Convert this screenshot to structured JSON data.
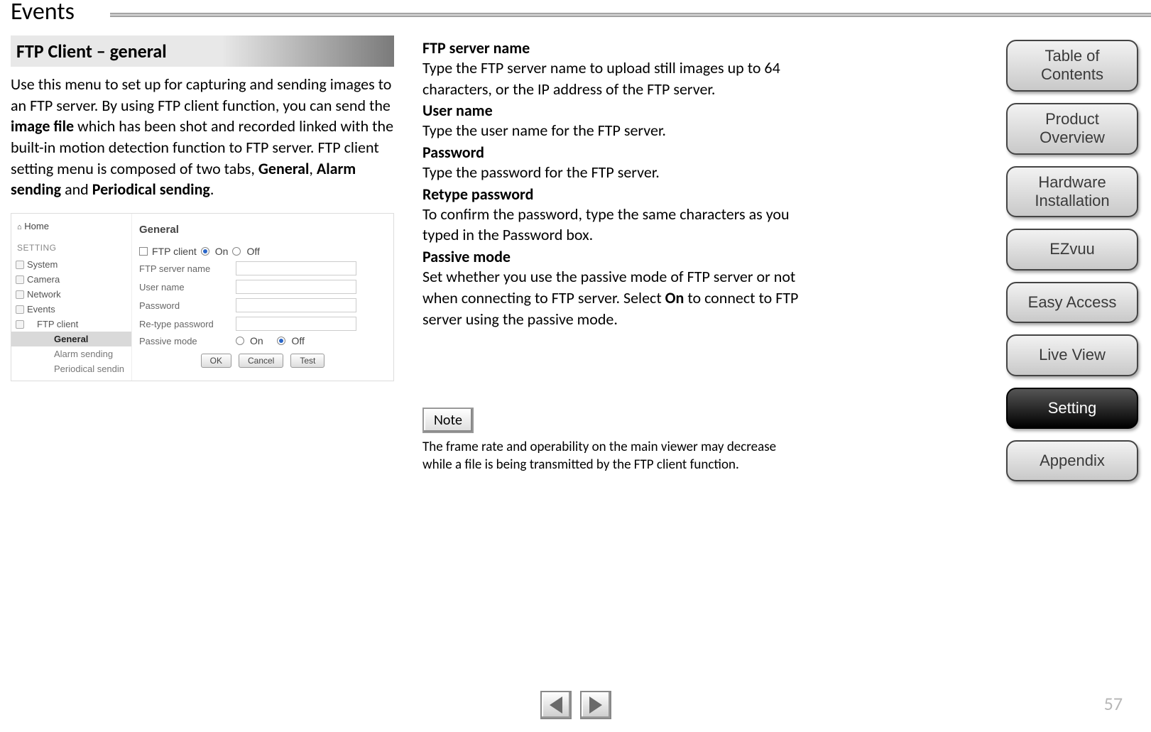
{
  "page_title": "Events",
  "section_heading": "FTP Client – general",
  "intro_parts": {
    "p1": "Use this menu to set up for capturing and sending images to an FTP server. By using FTP client function, you can send the ",
    "b1": "image file",
    "p2": " which has been shot and recorded linked with the built-in motion detection function to FTP server. FTP client setting menu is composed of two tabs, ",
    "b2": "General",
    "comma": ", ",
    "b3": "Alarm sending",
    "and": " and ",
    "b4": "Periodical sending",
    "end": "."
  },
  "screenshot": {
    "home": "Home",
    "setting_header": "SETTING",
    "tree": [
      "System",
      "Camera",
      "Network",
      "Events"
    ],
    "sub": "FTP client",
    "sub2": [
      "General",
      "Alarm sending",
      "Periodical sendin"
    ],
    "main_heading": "General",
    "ftp_client_label": "FTP client",
    "on": "On",
    "off": "Off",
    "rows": [
      "FTP server name",
      "User name",
      "Password",
      "Re-type password",
      "Passive mode"
    ],
    "buttons": [
      "OK",
      "Cancel",
      "Test"
    ]
  },
  "definitions": [
    {
      "term": "FTP server name",
      "desc": "Type the FTP server name to upload still images up to 64 characters, or the IP address of the FTP server."
    },
    {
      "term": "User name",
      "desc": "Type the user name for the FTP server."
    },
    {
      "term": "Password",
      "desc": "Type the password for the FTP server."
    },
    {
      "term": "Retype password",
      "desc": "To confirm the password, type the same characters as you typed in the Password box."
    }
  ],
  "passive": {
    "term": "Passive mode",
    "p1": "Set whether you use the passive mode of FTP server or not when connecting to FTP server. Select ",
    "b1": "On",
    "p2": " to connect to FTP server using the passive mode."
  },
  "note_label": "Note",
  "note_text": "The frame rate and operability on the main viewer may decrease while a file is being transmitted by the FTP client function.",
  "page_number": "57",
  "side_nav": [
    {
      "label": "Table of Contents",
      "lines": [
        "Table of",
        "Contents"
      ],
      "active": false
    },
    {
      "label": "Product Overview",
      "lines": [
        "Product",
        "Overview"
      ],
      "active": false
    },
    {
      "label": "Hardware Installation",
      "lines": [
        "Hardware",
        "Installation"
      ],
      "active": false
    },
    {
      "label": "EZvuu",
      "lines": [
        "EZvuu"
      ],
      "active": false
    },
    {
      "label": "Easy Access",
      "lines": [
        "Easy Access"
      ],
      "active": false
    },
    {
      "label": "Live View",
      "lines": [
        "Live View"
      ],
      "active": false
    },
    {
      "label": "Setting",
      "lines": [
        "Setting"
      ],
      "active": true
    },
    {
      "label": "Appendix",
      "lines": [
        "Appendix"
      ],
      "active": false
    }
  ]
}
